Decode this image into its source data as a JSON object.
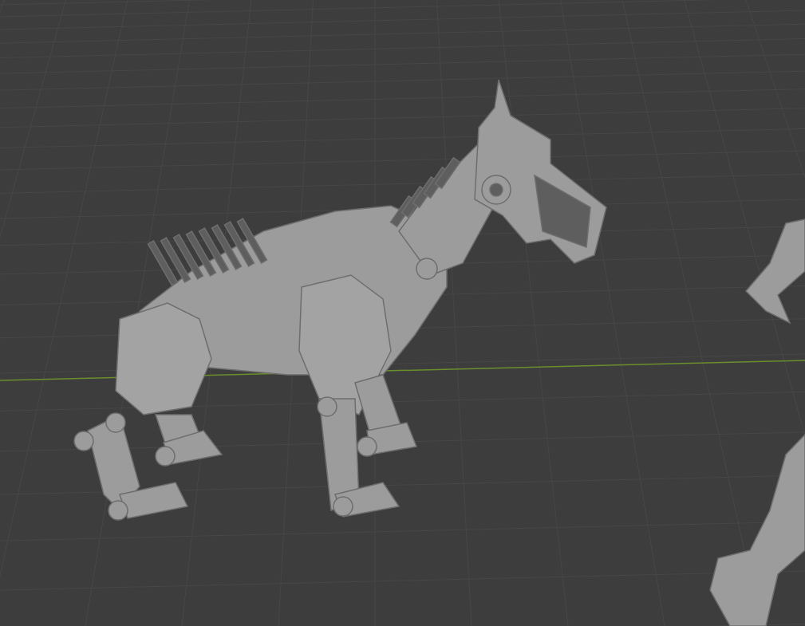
{
  "viewport": {
    "grid": true,
    "x_axis": true
  }
}
